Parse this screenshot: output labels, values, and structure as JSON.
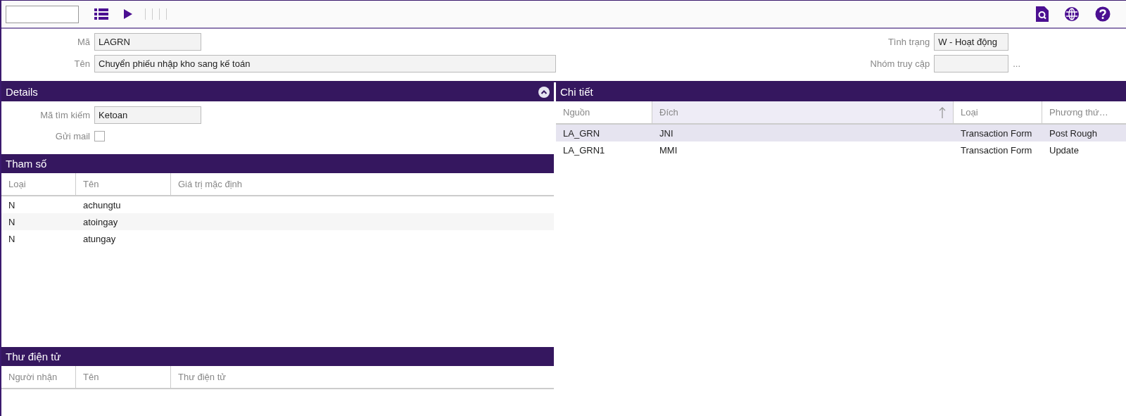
{
  "header_form": {
    "left": [
      {
        "label": "Mã",
        "value": "LAGRN",
        "kind": "short"
      },
      {
        "label": "Tên",
        "value": "Chuyển phiếu nhập kho sang kế toán",
        "kind": "long"
      }
    ],
    "right": [
      {
        "label": "Tình trạng",
        "value": "W - Hoạt động"
      },
      {
        "label": "Nhóm truy cập",
        "more": "..."
      }
    ]
  },
  "details": {
    "title": "Details",
    "expanded": true,
    "search_code": {
      "label": "Mã tìm kiếm",
      "value": "Ketoan"
    },
    "send_mail": {
      "label": "Gửi mail",
      "checked": false
    }
  },
  "parameters": {
    "title": "Tham số",
    "columns": [
      "Loại",
      "Tên",
      "Giá trị mặc định"
    ],
    "rows": [
      [
        "N",
        "achungtu"
      ],
      [
        "N",
        "atoingay"
      ],
      [
        "N",
        "atungay"
      ]
    ]
  },
  "email": {
    "title": "Thư điện tử",
    "columns": [
      "Người nhận",
      "Tên",
      "Thư điện tử"
    ]
  },
  "chi_tiet": {
    "title": "Chi tiết",
    "columns": [
      {
        "label": "Nguồn",
        "sorted": false
      },
      {
        "label": "Đích",
        "sorted": true
      },
      {
        "label": "Loại",
        "sorted": false
      },
      {
        "label": "Phương thứ…",
        "sorted": false
      }
    ],
    "rows": [
      {
        "cells": [
          "LA_GRN",
          "JNI",
          "Transaction Form",
          "Post Rough"
        ],
        "selected": true
      },
      {
        "cells": [
          "LA_GRN1",
          "MMI",
          "Transaction Form",
          "Update"
        ],
        "selected": false
      }
    ]
  }
}
